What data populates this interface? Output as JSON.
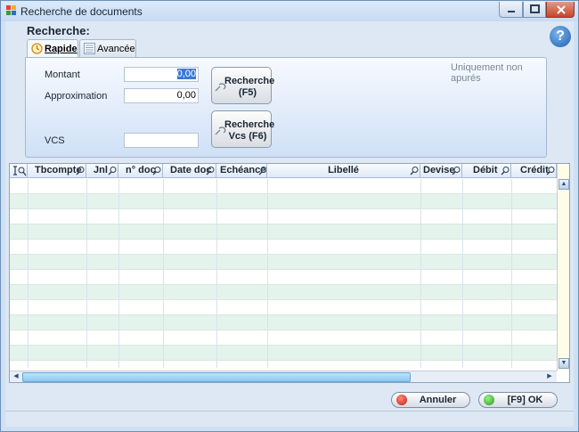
{
  "window": {
    "title": "Recherche de documents"
  },
  "header": {
    "section_title": "Recherche:",
    "help_icon": "question-icon",
    "help_glyph": "?"
  },
  "tabs": [
    {
      "label": "Rapide",
      "icon": "clock-icon",
      "active": true
    },
    {
      "label": "Avancée",
      "icon": "list-icon",
      "active": false
    }
  ],
  "form": {
    "montant": {
      "label": "Montant",
      "value": "0,00"
    },
    "approximation": {
      "label": "Approximation",
      "value": "0,00"
    },
    "vcs": {
      "label": "VCS",
      "value": ""
    },
    "note": "Uniquement non apurés"
  },
  "buttons": {
    "recherche": "Recherche\n(F5)",
    "recherche_vcs": "Recherche\nVcs (F6)",
    "annuler": "Annuler",
    "ok": "[F9]  OK"
  },
  "table": {
    "columns": [
      "",
      "Tbcompte",
      "Jnl",
      "n° doc",
      "Date doc",
      "Echéance",
      "Libellé",
      "Devise",
      "Débit",
      "Crédit"
    ],
    "rows": []
  },
  "colors": {
    "row_alt": "#e4f3ec",
    "accent": "#3a78d8",
    "scroll_thumb": "#8ac8f2"
  }
}
